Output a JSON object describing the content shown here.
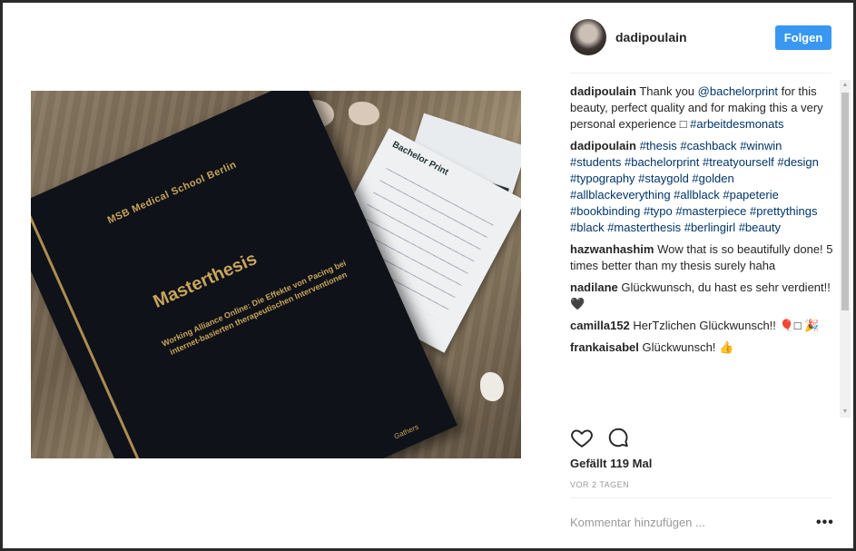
{
  "post": {
    "username": "dadipoulain",
    "follow_label": "Folgen",
    "image": {
      "book_school": "MSB Medical School Berlin",
      "book_title": "Masterthesis",
      "book_subtitle": "Working Alliance Online: Die Effekte von Pacing bei internet-basierten therapeutischen Interventionen",
      "book_author": "Gathers",
      "card_brand": "Bachelor Print"
    }
  },
  "comments": [
    {
      "user": "dadipoulain",
      "text": " Thank you ",
      "mention": "@bachelorprint",
      "text2": " for this beauty, perfect quality and for making this a very personal experience □ ",
      "tags": "#arbeitdesmonats"
    },
    {
      "user": "dadipoulain",
      "text": " ",
      "tags": "#thesis #cashback #winwin #students #bachelorprint #treatyourself #design #typography #staygold #golden #allblackeverything #allblack #papeterie #bookbinding #typo #masterpiece #prettythings #black #masterthesis #berlingirl #beauty"
    },
    {
      "user": "hazwanhashim",
      "text": " Wow that is so beautifully done! 5 times better than my thesis surely haha"
    },
    {
      "user": "nadilane",
      "text": " Glückwunsch, du hast es sehr verdient!! 🖤"
    },
    {
      "user": "camilla152",
      "text": " HerTzlichen Glückwunsch!! 🎈□ 🎉"
    },
    {
      "user": "frankaisabel",
      "text": " Glückwunsch! 👍"
    }
  ],
  "likes_label": "Gefällt 119 Mal",
  "timestamp": "VOR 2 TAGEN",
  "add_comment_placeholder": "Kommentar hinzufügen ...",
  "more_options": "•••",
  "icons": {
    "like": "heart-icon",
    "comment": "comment-bubble-icon",
    "more": "more-options-icon"
  },
  "colors": {
    "follow_button": "#3897f0",
    "hashtag": "#003569",
    "muted": "#999999"
  }
}
